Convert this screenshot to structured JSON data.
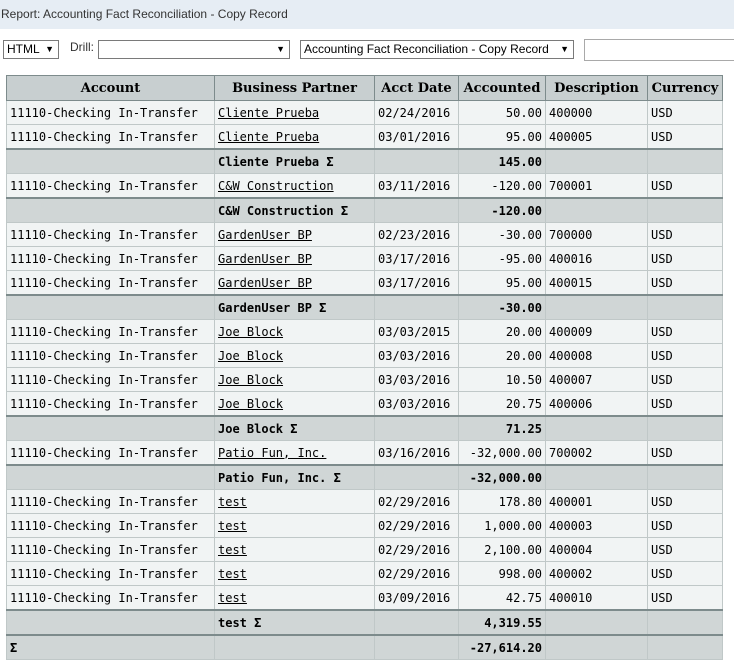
{
  "title": "Report: Accounting Fact Reconciliation - Copy Record",
  "toolbar": {
    "format": "HTML",
    "drill_label": "Drill:",
    "drill_value": "",
    "report_view": "Accounting Fact Reconciliation - Copy Record"
  },
  "columns": [
    "Account",
    "Business Partner",
    "Acct Date",
    "Accounted",
    "Description",
    "Currency"
  ],
  "sigma": "Σ",
  "rows": [
    {
      "type": "data",
      "account": "11110-Checking In-Transfer",
      "bp": "Cliente Prueba",
      "date": "02/24/2016",
      "amount": "50.00",
      "desc": "400000",
      "currency": "USD"
    },
    {
      "type": "data",
      "account": "11110-Checking In-Transfer",
      "bp": "Cliente Prueba",
      "date": "03/01/2016",
      "amount": "95.00",
      "desc": "400005",
      "currency": "USD"
    },
    {
      "type": "sum",
      "bp": "Cliente Prueba",
      "amount": "145.00"
    },
    {
      "type": "data",
      "account": "11110-Checking In-Transfer",
      "bp": "C&W Construction",
      "date": "03/11/2016",
      "amount": "-120.00",
      "desc": "700001",
      "currency": "USD"
    },
    {
      "type": "sum",
      "bp": "C&W Construction",
      "amount": "-120.00"
    },
    {
      "type": "data",
      "account": "11110-Checking In-Transfer",
      "bp": "GardenUser BP",
      "date": "02/23/2016",
      "amount": "-30.00",
      "desc": "700000",
      "currency": "USD"
    },
    {
      "type": "data",
      "account": "11110-Checking In-Transfer",
      "bp": "GardenUser BP",
      "date": "03/17/2016",
      "amount": "-95.00",
      "desc": "400016",
      "currency": "USD"
    },
    {
      "type": "data",
      "account": "11110-Checking In-Transfer",
      "bp": "GardenUser BP",
      "date": "03/17/2016",
      "amount": "95.00",
      "desc": "400015",
      "currency": "USD"
    },
    {
      "type": "sum",
      "bp": "GardenUser BP",
      "amount": "-30.00"
    },
    {
      "type": "data",
      "account": "11110-Checking In-Transfer",
      "bp": "Joe Block",
      "date": "03/03/2015",
      "amount": "20.00",
      "desc": "400009",
      "currency": "USD"
    },
    {
      "type": "data",
      "account": "11110-Checking In-Transfer",
      "bp": "Joe Block",
      "date": "03/03/2016",
      "amount": "20.00",
      "desc": "400008",
      "currency": "USD"
    },
    {
      "type": "data",
      "account": "11110-Checking In-Transfer",
      "bp": "Joe Block",
      "date": "03/03/2016",
      "amount": "10.50",
      "desc": "400007",
      "currency": "USD"
    },
    {
      "type": "data",
      "account": "11110-Checking In-Transfer",
      "bp": "Joe Block",
      "date": "03/03/2016",
      "amount": "20.75",
      "desc": "400006",
      "currency": "USD"
    },
    {
      "type": "sum",
      "bp": "Joe Block",
      "amount": "71.25"
    },
    {
      "type": "data",
      "account": "11110-Checking In-Transfer",
      "bp": "Patio Fun, Inc.",
      "date": "03/16/2016",
      "amount": "-32,000.00",
      "desc": "700002",
      "currency": "USD"
    },
    {
      "type": "sum",
      "bp": "Patio Fun, Inc.",
      "amount": "-32,000.00"
    },
    {
      "type": "data",
      "account": "11110-Checking In-Transfer",
      "bp": "test",
      "date": "02/29/2016",
      "amount": "178.80",
      "desc": "400001",
      "currency": "USD"
    },
    {
      "type": "data",
      "account": "11110-Checking In-Transfer",
      "bp": "test",
      "date": "02/29/2016",
      "amount": "1,000.00",
      "desc": "400003",
      "currency": "USD"
    },
    {
      "type": "data",
      "account": "11110-Checking In-Transfer",
      "bp": "test",
      "date": "02/29/2016",
      "amount": "2,100.00",
      "desc": "400004",
      "currency": "USD"
    },
    {
      "type": "data",
      "account": "11110-Checking In-Transfer",
      "bp": "test",
      "date": "02/29/2016",
      "amount": "998.00",
      "desc": "400002",
      "currency": "USD"
    },
    {
      "type": "data",
      "account": "11110-Checking In-Transfer",
      "bp": "test",
      "date": "03/09/2016",
      "amount": "42.75",
      "desc": "400010",
      "currency": "USD"
    },
    {
      "type": "sum",
      "bp": "test",
      "amount": "4,319.55"
    },
    {
      "type": "grand",
      "amount": "-27,614.20"
    }
  ]
}
